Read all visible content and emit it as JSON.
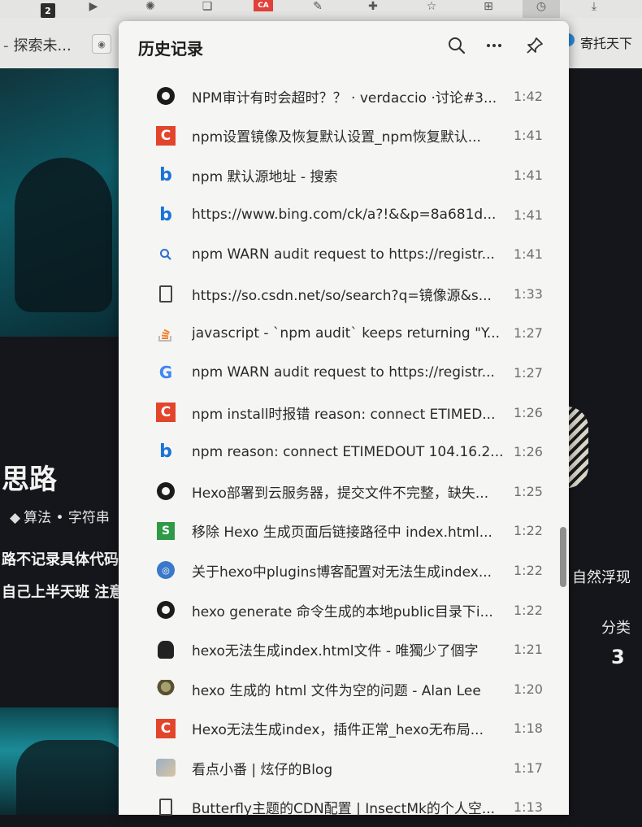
{
  "browser": {
    "tab_badge": "2",
    "toolbar_red_label": "CA",
    "bookmarks": {
      "left_label": "探索未...",
      "right_label": "寄托天下"
    }
  },
  "background_page": {
    "post_title": "思路",
    "post_tags": "算法 • 字符串",
    "body_line1": "路不记录具体代码",
    "body_line2": "自己上半天班 注意",
    "right_text": "自然浮现",
    "category_label": "分类",
    "category_count": "3"
  },
  "history_panel": {
    "title": "历史记录",
    "search_icon": "search-icon",
    "more_icon": "more-icon",
    "pin_icon": "pin-icon",
    "items": [
      {
        "icon": "github-icon",
        "title": "NPM审计有时会超时？？ · verdaccio ·讨论#3...",
        "time": "1:42"
      },
      {
        "icon": "csdn-icon",
        "title": "npm设置镜像及恢复默认设置_npm恢复默认...",
        "time": "1:41"
      },
      {
        "icon": "bing-icon",
        "title": "npm 默认源地址 - 搜索",
        "time": "1:41"
      },
      {
        "icon": "bing-icon",
        "title": "https://www.bing.com/ck/a?!&&p=8a681d...",
        "time": "1:41"
      },
      {
        "icon": "search-icon",
        "title": "npm WARN audit request to https://registr...",
        "time": "1:41"
      },
      {
        "icon": "document-icon",
        "title": "https://so.csdn.net/so/search?q=镜像源&s...",
        "time": "1:33"
      },
      {
        "icon": "stackoverflow-icon",
        "title": "javascript - `npm audit` keeps returning \"Y...",
        "time": "1:27"
      },
      {
        "icon": "google-icon",
        "title": "npm WARN audit request to https://registr...",
        "time": "1:27"
      },
      {
        "icon": "csdn-icon",
        "title": "npm install时报错 reason: connect ETIMED...",
        "time": "1:26"
      },
      {
        "icon": "bing-icon",
        "title": "npm reason: connect ETIMEDOUT 104.16.2...",
        "time": "1:26"
      },
      {
        "icon": "github-icon",
        "title": "Hexo部署到云服务器，提交文件不完整，缺失...",
        "time": "1:25"
      },
      {
        "icon": "segmentfault-icon",
        "title": "移除 Hexo 生成页面后链接路径中 index.html...",
        "time": "1:22"
      },
      {
        "icon": "round-site-icon",
        "title": "关于hexo中plugins博客配置对无法生成index...",
        "time": "1:22"
      },
      {
        "icon": "github-icon",
        "title": "hexo generate 命令生成的本地public目录下i...",
        "time": "1:22"
      },
      {
        "icon": "dark-avatar-icon",
        "title": "hexo无法生成index.html文件 - 唯獨少了個字",
        "time": "1:21"
      },
      {
        "icon": "pixel-avatar-icon",
        "title": "hexo 生成的 html 文件为空的问题 - Alan Lee",
        "time": "1:20"
      },
      {
        "icon": "csdn-icon",
        "title": "Hexo无法生成index，插件正常_hexo无布局...",
        "time": "1:18"
      },
      {
        "icon": "cartoon-avatar-icon",
        "title": "看点小番 | 炫仔的Blog",
        "time": "1:17"
      },
      {
        "icon": "document-icon",
        "title": "Butterfly主题的CDN配置 | InsectMk的个人空...",
        "time": "1:13"
      }
    ]
  }
}
